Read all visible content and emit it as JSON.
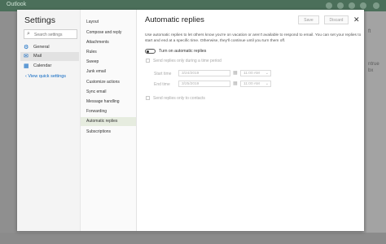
{
  "app": {
    "brand": "Outlook"
  },
  "background": {
    "right_text": [
      "ft",
      "ntrue",
      "bx"
    ]
  },
  "settings": {
    "title": "Settings",
    "search_placeholder": "Search settings",
    "categories": [
      {
        "label": "General",
        "icon": "gear-icon",
        "glyph": "⚙"
      },
      {
        "label": "Mail",
        "icon": "mail-icon",
        "glyph": "✉"
      },
      {
        "label": "Calendar",
        "icon": "calendar-icon",
        "glyph": "▦"
      }
    ],
    "selected_category": "Mail",
    "quick_settings": "‹ View quick settings"
  },
  "mail_nav": {
    "items": [
      "Layout",
      "Compose and reply",
      "Attachments",
      "Rules",
      "Sweep",
      "Junk email",
      "Customize actions",
      "Sync email",
      "Message handling",
      "Forwarding",
      "Automatic replies",
      "Subscriptions"
    ],
    "selected": "Automatic replies"
  },
  "automatic_replies": {
    "title": "Automatic replies",
    "save_label": "Save",
    "discard_label": "Discard",
    "description": "Use automatic replies to let others know you're on vacation or aren't available to respond to email. You can set your replies to start and end at a specific time. Otherwise, they'll continue until you turn them off.",
    "toggle_label": "Turn on automatic replies",
    "toggle_on": false,
    "time_period_label": "Send replies only during a time period",
    "start_time_label": "Start time",
    "start_date": "3/24/2019",
    "start_time": "11:00 AM",
    "end_time_label": "End time",
    "end_date": "3/25/2019",
    "end_time": "11:00 AM",
    "contacts_label": "Send replies only to contacts"
  },
  "colors": {
    "accent": "#0a66c2",
    "selected_bg": "#e6ecdf",
    "header": "#4b6f5a"
  }
}
